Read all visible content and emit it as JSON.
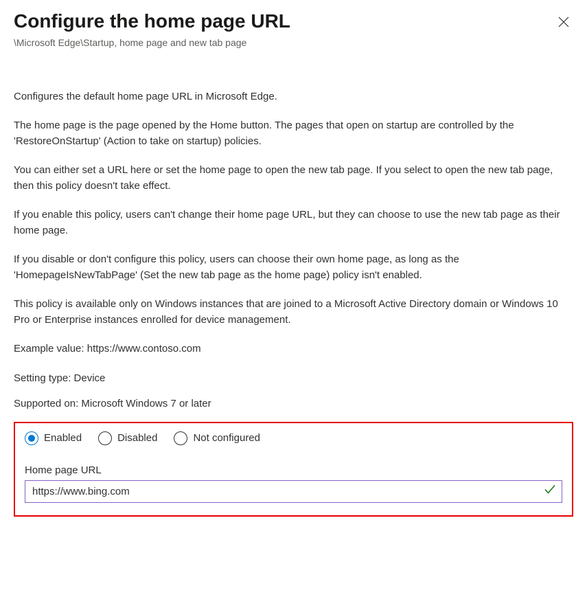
{
  "header": {
    "title": "Configure the home page URL",
    "breadcrumb": "\\Microsoft Edge\\Startup, home page and new tab page"
  },
  "description": {
    "p1": "Configures the default home page URL in Microsoft Edge.",
    "p2": "The home page is the page opened by the Home button. The pages that open on startup are controlled by the 'RestoreOnStartup' (Action to take on startup) policies.",
    "p3": "You can either set a URL here or set the home page to open the new tab page. If you select to open the new tab page, then this policy doesn't take effect.",
    "p4": "If you enable this policy, users can't change their home page URL, but they can choose to use the new tab page as their home page.",
    "p5": "If you disable or don't configure this policy, users can choose their own home page, as long as the 'HomepageIsNewTabPage' (Set the new tab page as the home page) policy isn't enabled.",
    "p6": "This policy is available only on Windows instances that are joined to a Microsoft Active Directory domain or Windows 10 Pro or Enterprise instances enrolled for device management.",
    "example": "Example value: https://www.contoso.com"
  },
  "meta": {
    "setting_type": "Setting type: Device",
    "supported_on": "Supported on: Microsoft Windows 7 or later"
  },
  "options": {
    "enabled": "Enabled",
    "disabled": "Disabled",
    "not_configured": "Not configured"
  },
  "field": {
    "label": "Home page URL",
    "value": "https://www.bing.com"
  }
}
